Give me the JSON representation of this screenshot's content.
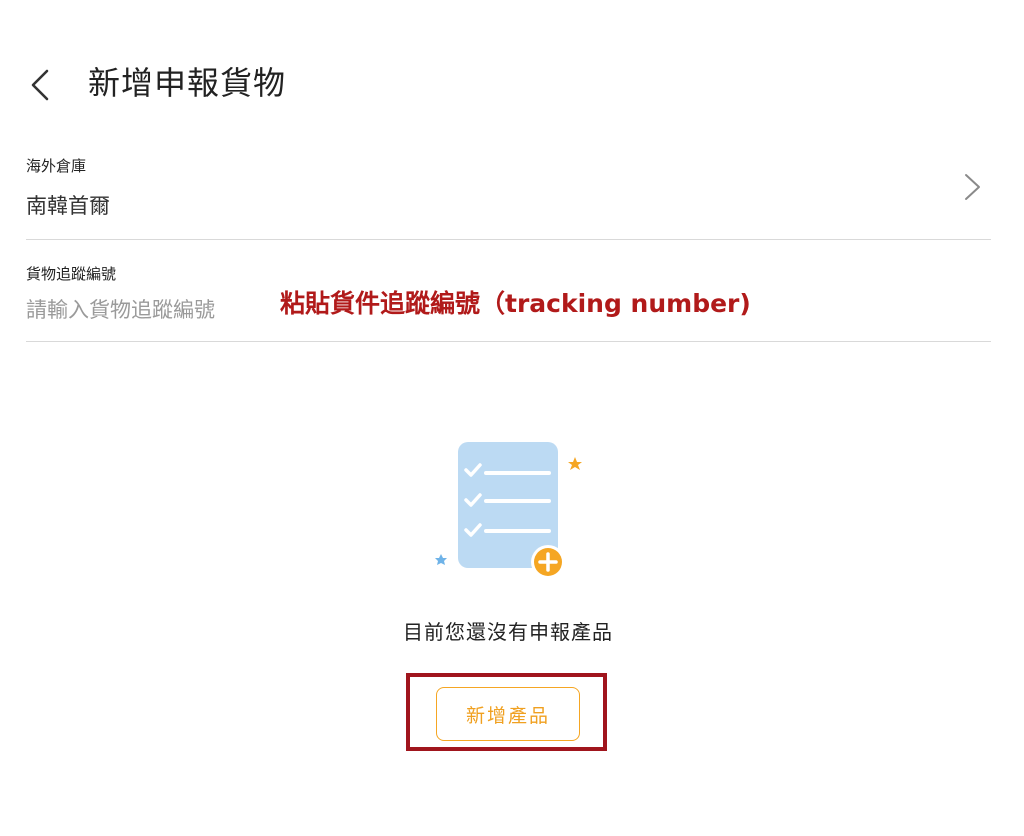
{
  "header": {
    "title": "新增申報貨物",
    "back_icon": "chevron-left-icon"
  },
  "warehouse": {
    "label": "海外倉庫",
    "value": "南韓首爾",
    "chevron_icon": "chevron-right-icon"
  },
  "tracking": {
    "label": "貨物追蹤編號",
    "placeholder": "請輸入貨物追蹤編號",
    "annotation": "粘貼貨件追蹤編號（tracking number)"
  },
  "empty_state": {
    "illustration_icon": "checklist-add-icon",
    "message": "目前您還沒有申報產品",
    "add_button_label": "新增產品"
  },
  "colors": {
    "accent": "#f5a623",
    "annotation_red": "#b11a1a",
    "highlight_border": "#a0151d",
    "illustration_blue": "#bcdaf3",
    "divider": "#d9d9d9"
  }
}
